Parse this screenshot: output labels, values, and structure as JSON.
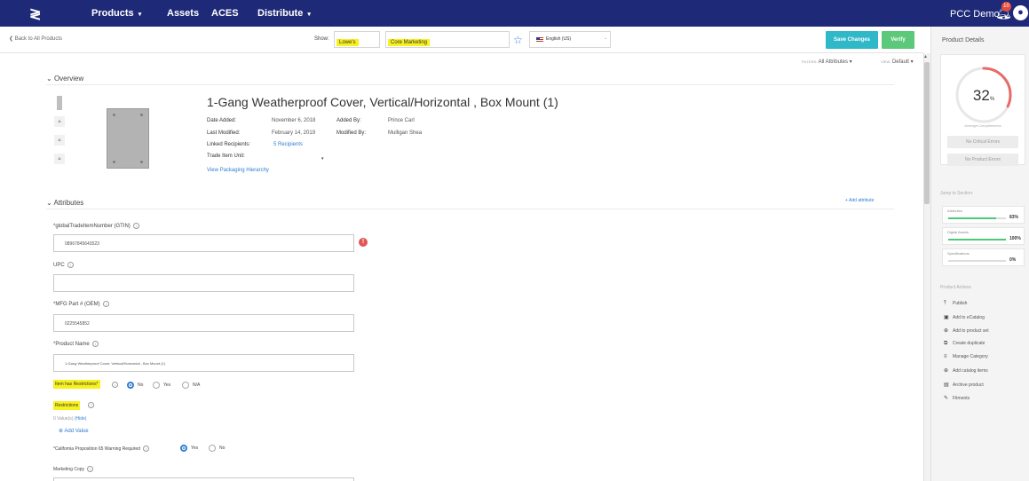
{
  "nav": {
    "logo": "≷",
    "items": [
      {
        "label": "Products",
        "caret": "▾"
      },
      {
        "label": "Assets",
        "caret": ""
      },
      {
        "label": "ACES",
        "caret": ""
      },
      {
        "label": "Distribute",
        "caret": "▾"
      }
    ],
    "account": "PCC Demo ⌄",
    "notification_count": "10"
  },
  "toolbar": {
    "back_label": "❮ Back to All Products",
    "show_label": "Show:",
    "recipient": "Lowe's",
    "catalog": "Core Marketing",
    "language": "English (US)",
    "save_label": "Save Changes",
    "verify_label": "Verify"
  },
  "filters": {
    "label": "FILTERS:",
    "value": "All Attributes ▾"
  },
  "view": {
    "label": "VIEW:",
    "value": "Default ▾"
  },
  "overview": {
    "title": "Overview",
    "product_title": "1-Gang Weatherproof Cover, Vertical/Horizontal , Box Mount (1)",
    "date_added_label": "Date Added:",
    "date_added": "November 6, 2018",
    "added_by_label": "Added By:",
    "added_by": "Prince Carl",
    "last_modified_label": "Last Modified:",
    "last_modified": "February 14, 2019",
    "modified_by_label": "Modified By:",
    "modified_by": "Mulligan Shea",
    "linked_label": "Linked Recipients:",
    "linked_value": "5 Recipients",
    "trade_unit_label": "Trade Item Unit:",
    "packaging_link": "View Packaging Hierarchy"
  },
  "attributes": {
    "title": "Attributes",
    "add_label": "+ Add attribute",
    "gtin_label": "*globalTradeItemNumber (GTIN)",
    "gtin_value": "08967845643523",
    "upc_label": "UPC",
    "upc_value": "",
    "mfg_label": "*MFG Part # (OEM)",
    "mfg_value": "0225545852",
    "name_label": "*Product Name",
    "name_value": "1-Gang Weatherproof Cover, Vertical/Horizontal , Box Mount (1)",
    "restrictions_flag_label": "Item has Restrictions*",
    "restrictions_flag_options": [
      "No",
      "Yes",
      "N/A"
    ],
    "restrictions_label": "Restrictions",
    "restrictions_count": "0 Value(s)",
    "hide_label": "(Hide)",
    "add_value_label": "⊕ Add Value",
    "prop65_label": "*California Proposition 65 Warning Required",
    "prop65_options": [
      "Yes",
      "No"
    ],
    "marketing_label": "Marketing Copy"
  },
  "sidebar": {
    "title": "Product Details",
    "completeness_value": "32",
    "completeness_unit": "%",
    "completeness_fraction": 0.32,
    "completeness_label": "Average Completeness",
    "critical_errors": "No Critical Errors",
    "product_errors": "No Product Errors",
    "jump_label": "Jump to Section:",
    "sections": [
      {
        "name": "Attributes",
        "pct": "83%",
        "fraction": 0.83
      },
      {
        "name": "Digital Assets",
        "pct": "100%",
        "fraction": 1.0
      },
      {
        "name": "Specifications",
        "pct": "0%",
        "fraction": 0.0
      }
    ],
    "actions_label": "Product Actions",
    "actions": [
      {
        "icon": "⤒",
        "label": "Publish"
      },
      {
        "icon": "▣",
        "label": "Add to eCatalog"
      },
      {
        "icon": "⊕",
        "label": "Add to product set"
      },
      {
        "icon": "⧉",
        "label": "Create duplicate"
      },
      {
        "icon": "≡",
        "label": "Manage Category"
      },
      {
        "icon": "⊕",
        "label": "Add catalog items"
      },
      {
        "icon": "▤",
        "label": "Archive product"
      },
      {
        "icon": "✎",
        "label": "Fitments"
      }
    ]
  },
  "colors": {
    "nav": "#1e2a78",
    "accent": "#2f7fd1",
    "save": "#2fb8c7",
    "verify": "#5cc87a",
    "gauge": "#e86a6a",
    "highlight": "#f7f11f"
  }
}
